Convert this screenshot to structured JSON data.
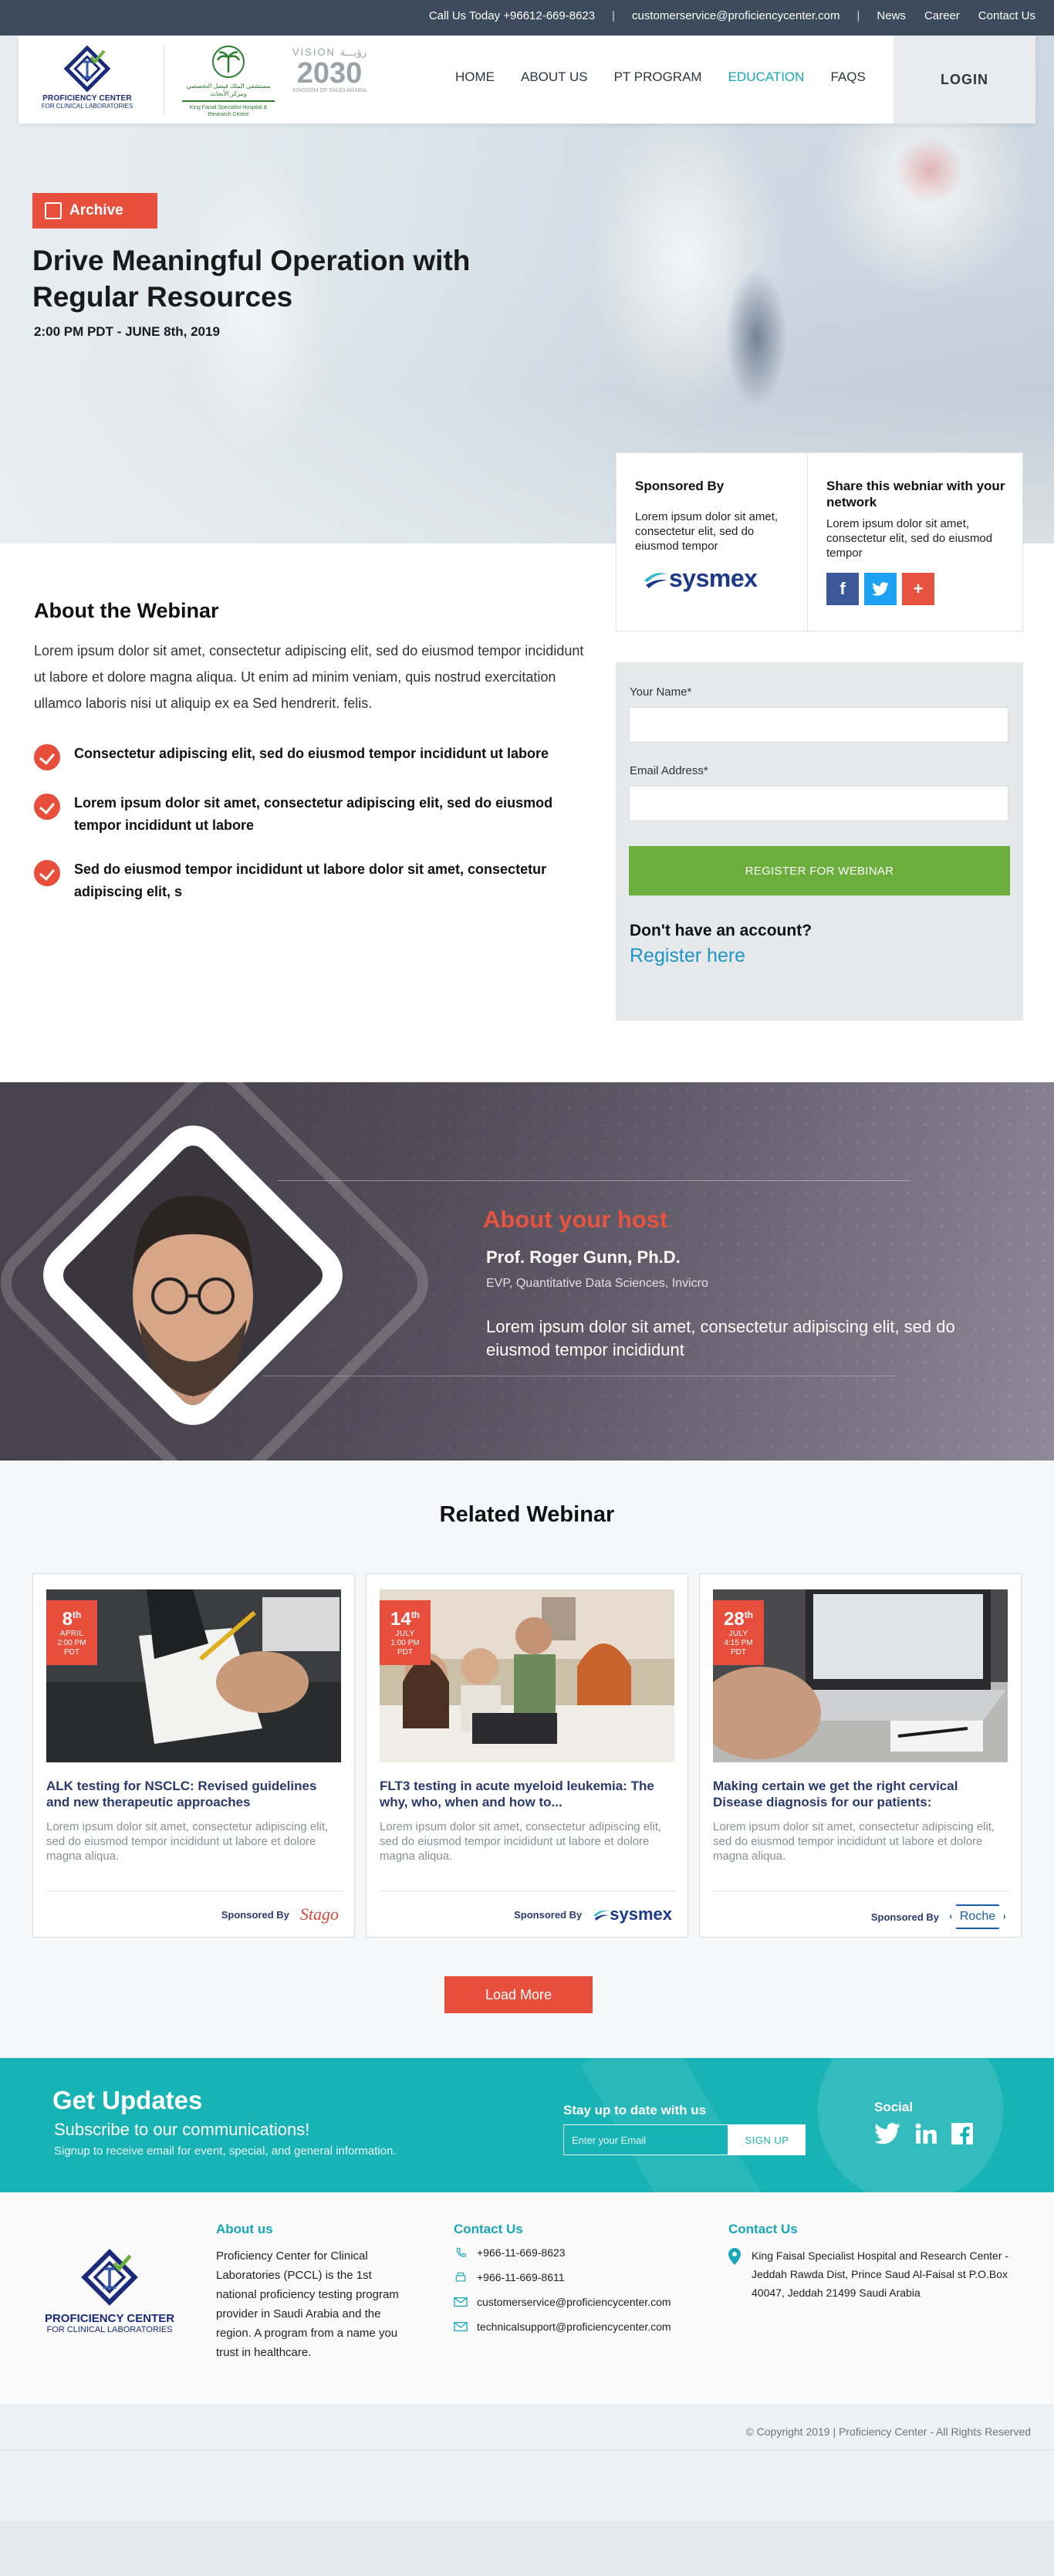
{
  "topbar": {
    "call_label": "Call Us Today",
    "phone": "+96612-669-8623",
    "separator": "|",
    "email": "customerservice@proficiencycenter.com",
    "links": [
      "News",
      "Career",
      "Contact Us"
    ]
  },
  "header": {
    "logo_line1": "PROFICIENCY CENTER",
    "logo_line2": "FOR CLINICAL LABORATORIES",
    "kfsh_ar": "مستشفى الملك فيصل التخصصي ومركز الأبحاث",
    "kfsh_en": "King Faisal Specialist Hospital & Research Centre",
    "vision_top": "VISION",
    "vision_ar": "رؤيـــة",
    "vision_year": "2030",
    "vision_bottom": "KINGDOM OF SAUDI ARABIA",
    "nav": [
      "HOME",
      "ABOUT US",
      "PT PROGRAM",
      "EDUCATION",
      "FAQS"
    ],
    "login": "LOGIN"
  },
  "hero": {
    "badge": "Archive",
    "title": "Drive Meaningful Operation with Regular Resources",
    "date": "2:00 PM PDT - JUNE 8th, 2019"
  },
  "sponsor": {
    "title": "Sponsored By",
    "text": "Lorem ipsum dolor sit amet, consectetur elit, sed do eiusmod tempor",
    "logo": "sysmex"
  },
  "share": {
    "title": "Share this webniar with your network",
    "text": "Lorem ipsum dolor sit amet, consectetur elit, sed do eiusmod tempor",
    "icons": [
      "facebook-icon",
      "twitter-icon",
      "plus-icon"
    ],
    "colors": [
      "#3b5998",
      "#1da1f2",
      "#e8533f"
    ]
  },
  "about": {
    "title": "About the Webinar",
    "text": "Lorem ipsum dolor sit amet, consectetur adipiscing elit, sed do eiusmod tempor incididunt ut labore et dolore magna aliqua. Ut enim ad minim veniam, quis nostrud exercitation ullamco laboris nisi ut aliquip ex ea Sed hendrerit. felis.",
    "points": [
      "Consectetur adipiscing elit, sed do eiusmod tempor incididunt ut labore",
      "Lorem ipsum dolor sit amet, consectetur adipiscing elit, sed do eiusmod tempor incididunt ut labore",
      "Sed do eiusmod tempor incididunt ut labore  dolor sit amet, consectetur adipiscing elit, s"
    ]
  },
  "form": {
    "name_label": "Your Name*",
    "name_value": "",
    "email_label": "Email Address*",
    "email_value": "",
    "submit": "REGISTER FOR WEBINAR",
    "question": "Don't have an account?",
    "register": "Register here"
  },
  "host": {
    "heading": "About your host",
    "name": "Prof. Roger Gunn, Ph.D.",
    "role": "EVP, Quantitative Data Sciences, Invicro",
    "desc": "Lorem ipsum dolor sit amet, consectetur adipiscing elit, sed do eiusmod tempor incididunt"
  },
  "related": {
    "title": "Related Webinar",
    "sponsored_label": "Sponsored By",
    "cards": [
      {
        "day": "8",
        "suffix": "th",
        "month": "APRIL",
        "time": "2:00 PM",
        "tz": "PDT",
        "title": "ALK testing for NSCLC: Revised guidelines and new therapeutic approaches",
        "text": "Lorem ipsum dolor sit amet, consectetur adipiscing elit, sed do eiusmod tempor incididunt ut labore et dolore magna aliqua.",
        "sponsor": "Stago"
      },
      {
        "day": "14",
        "suffix": "th",
        "month": "JULY",
        "time": "1:00 PM",
        "tz": "PDT",
        "title": "FLT3 testing in acute myeloid leukemia: The why, who, when and how to...",
        "text": "Lorem ipsum dolor sit amet, consectetur adipiscing elit, sed do eiusmod tempor incididunt ut labore et dolore magna aliqua.",
        "sponsor": "sysmex"
      },
      {
        "day": "28",
        "suffix": "th",
        "month": "JULY",
        "time": "4:15 PM",
        "tz": "PDT",
        "title": "Making certain we get the right cervical Disease diagnosis for our patients:",
        "text": "Lorem ipsum dolor sit amet, consectetur adipiscing elit, sed do eiusmod tempor incididunt ut labore et dolore magna aliqua.",
        "sponsor": "Roche"
      }
    ],
    "load_more": "Load More"
  },
  "updates": {
    "title": "Get Updates",
    "subtitle": "Subscribe to our communications!",
    "small": "Signup to receive email for event, special, and general information.",
    "stay": "Stay up to date with us",
    "email_placeholder": "Enter your Email",
    "signup": "SIGN UP",
    "social": "Social"
  },
  "footer": {
    "logo_line1": "PROFICIENCY CENTER",
    "logo_line2": "FOR CLINICAL LABORATORIES",
    "about_title": "About us",
    "about_text": "Proficiency Center for Clinical Laboratories (PCCL) is the 1st national proficiency testing program provider in Saudi Arabia and the region. A program from a name you trust in healthcare.",
    "contact_title": "Contact Us",
    "phone": "+966-11-669-8623",
    "fax": "+966-11-669-8611",
    "email1": "customerservice@proficiencycenter.com",
    "email2": "technicalsupport@proficiencycenter.com",
    "contact2_title": "Contact Us",
    "address": "King Faisal Specialist Hospital and Research Center - Jeddah Rawda Dist, Prince Saud Al-Faisal st  P.O.Box 40047, Jeddah 21499 Saudi Arabia",
    "copyright": "© Copyright  2019  |  Proficiency Center - All Rights Reserved"
  },
  "colors": {
    "accent": "#e84e3c",
    "teal": "#17b3b5",
    "green": "#6bae3c",
    "navy": "#1b2a79",
    "link": "#1c95c9"
  }
}
